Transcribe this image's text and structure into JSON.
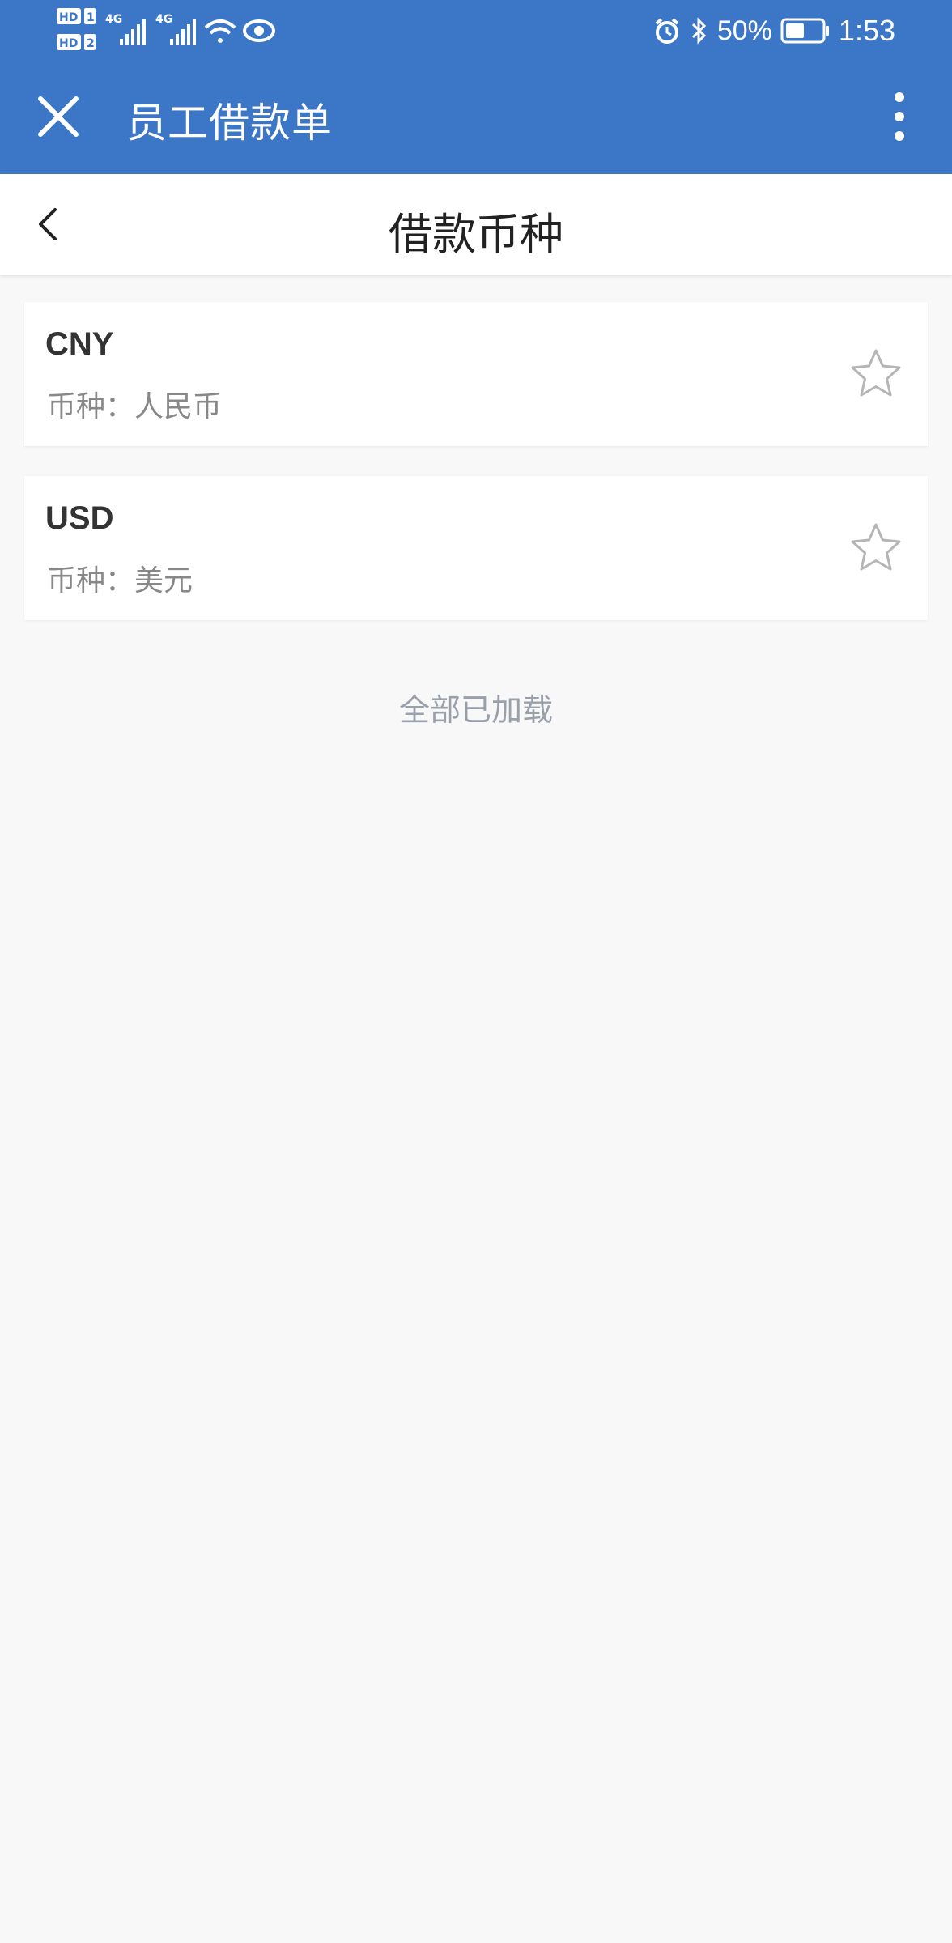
{
  "status_bar": {
    "hd1": "HD",
    "hd1_sim": "1",
    "hd2": "HD",
    "hd2_sim": "2",
    "net1": "4G",
    "net2": "4G",
    "battery": "50%",
    "time": "1:53"
  },
  "app_bar": {
    "title": "员工借款单"
  },
  "subheader": {
    "title": "借款币种"
  },
  "currencies": [
    {
      "code": "CNY",
      "desc": "币种：人民币"
    },
    {
      "code": "USD",
      "desc": "币种：美元"
    }
  ],
  "footer": {
    "end_text": "全部已加载"
  },
  "colors": {
    "primary": "#3b76c7",
    "background": "#f8f8f8"
  }
}
